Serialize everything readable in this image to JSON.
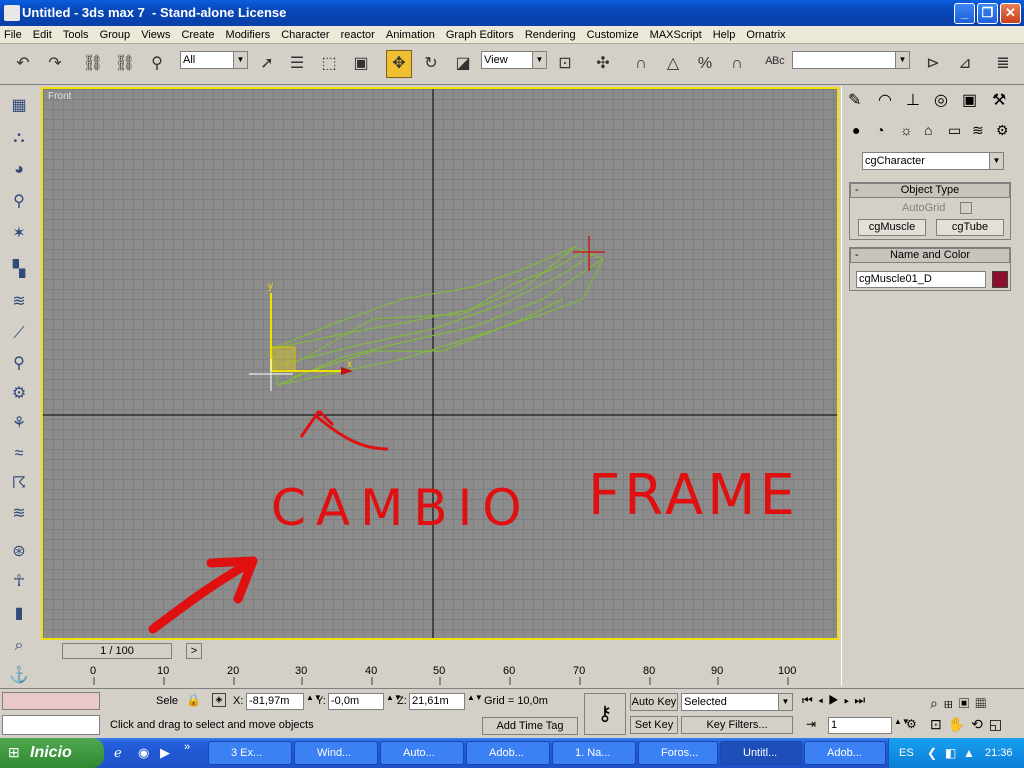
{
  "window": {
    "title": "Untitled - 3ds max 7  - Stand-alone License"
  },
  "menu": [
    "File",
    "Edit",
    "Tools",
    "Group",
    "Views",
    "Create",
    "Modifiers",
    "Character",
    "reactor",
    "Animation",
    "Graph Editors",
    "Rendering",
    "Customize",
    "MAXScript",
    "Help",
    "Ornatrix"
  ],
  "toolbar": {
    "selection_filter": "All",
    "ref_coord": "View",
    "named_selection": ""
  },
  "viewport": {
    "label": "Front",
    "axis_x": "x",
    "axis_y": "y"
  },
  "annotations": {
    "cambio": "CAMBIO",
    "frame": "FRAME"
  },
  "command_panel": {
    "category": "cgCharacter",
    "object_type": {
      "title": "Object Type",
      "autogrid": "AutoGrid",
      "buttons": [
        "cgMuscle",
        "cgTube"
      ]
    },
    "name_color": {
      "title": "Name and Color",
      "name": "cgMuscle01_D",
      "color": "#8b1030"
    }
  },
  "timeline": {
    "slider": "1 / 100",
    "ticks": [
      "0",
      "10",
      "20",
      "30",
      "40",
      "50",
      "60",
      "70",
      "80",
      "90",
      "100"
    ]
  },
  "status": {
    "selection": "Sele",
    "x_label": "X:",
    "x": "-81,97m",
    "y_label": "Y:",
    "y": "-0,0m",
    "z_label": "Z:",
    "z": "21,61m",
    "grid": "Grid = 10,0m",
    "prompt": "Click and drag to select and move objects",
    "add_time_tag": "Add Time Tag",
    "auto_key": "Auto Key",
    "set_key": "Set Key",
    "key_mode": "Selected",
    "key_filters": "Key Filters...",
    "frame": "1"
  },
  "taskbar": {
    "start": "Inicio",
    "tasks": [
      "3 Ex...",
      "Wind...",
      "Auto...",
      "Adob...",
      "1. Na...",
      "Foros...",
      "Untitl...",
      "Adob..."
    ],
    "lang": "ES",
    "clock": "21:36"
  }
}
